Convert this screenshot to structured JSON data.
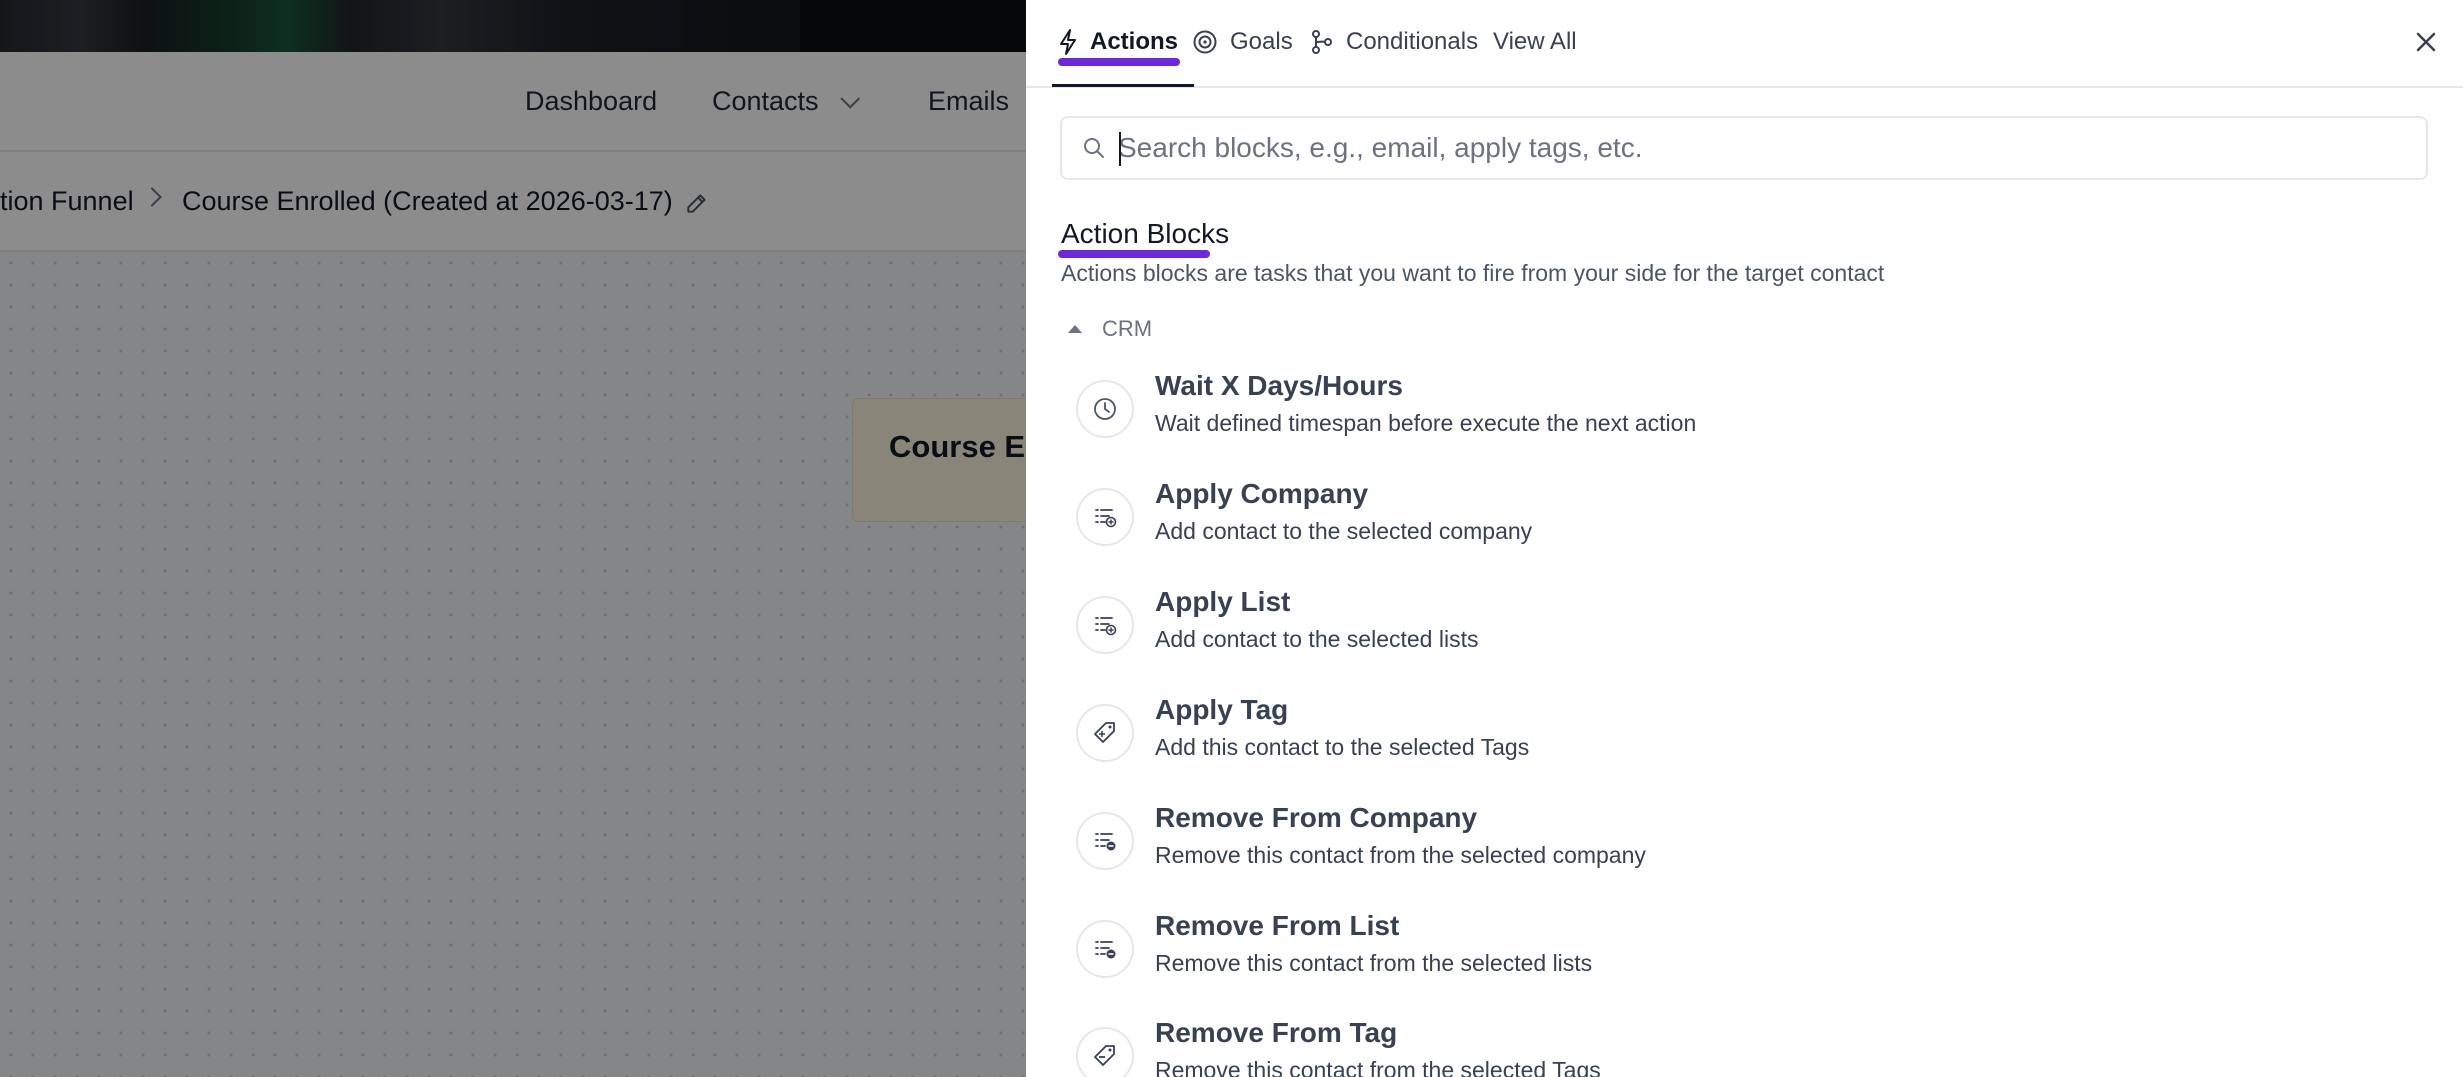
{
  "app": {
    "nav": [
      {
        "label": "Dashboard"
      },
      {
        "label": "Contacts"
      },
      {
        "label": "Emails"
      }
    ],
    "breadcrumb": {
      "parent": "tion Funnel",
      "current": "Course Enrolled (Created at 2026-03-17)"
    },
    "canvas_card": {
      "title": "Course Enr"
    }
  },
  "drawer": {
    "tabs": [
      {
        "label": "Actions",
        "icon": "bolt-icon",
        "active": true
      },
      {
        "label": "Goals",
        "icon": "target-icon",
        "active": false
      },
      {
        "label": "Conditionals",
        "icon": "branch-icon",
        "active": false
      },
      {
        "label": "View All",
        "icon": "",
        "active": false
      }
    ],
    "search": {
      "placeholder": "Search blocks, e.g., email, apply tags, etc.",
      "value": ""
    },
    "section": {
      "title": "Action Blocks",
      "description": "Actions blocks are tasks that you want to fire from your side for the target contact"
    },
    "group": {
      "label": "CRM",
      "expanded": true
    },
    "blocks": [
      {
        "title": "Wait X Days/Hours",
        "description": "Wait defined timespan before execute the next action",
        "icon": "clock-icon"
      },
      {
        "title": "Apply Company",
        "description": "Add contact to the selected company",
        "icon": "list-add-icon"
      },
      {
        "title": "Apply List",
        "description": "Add contact to the selected lists",
        "icon": "list-add-icon"
      },
      {
        "title": "Apply Tag",
        "description": "Add this contact to the selected Tags",
        "icon": "tag-add-icon"
      },
      {
        "title": "Remove From Company",
        "description": "Remove this contact from the selected company",
        "icon": "list-remove-icon"
      },
      {
        "title": "Remove From List",
        "description": "Remove this contact from the selected lists",
        "icon": "list-remove-icon"
      },
      {
        "title": "Remove From Tag",
        "description": "Remove this contact from the selected Tags",
        "icon": "tag-remove-icon"
      }
    ]
  },
  "colors": {
    "accent": "#6d28d9",
    "overlay": "rgba(0,0,0,0.45)",
    "card": "#fbf3dc"
  }
}
